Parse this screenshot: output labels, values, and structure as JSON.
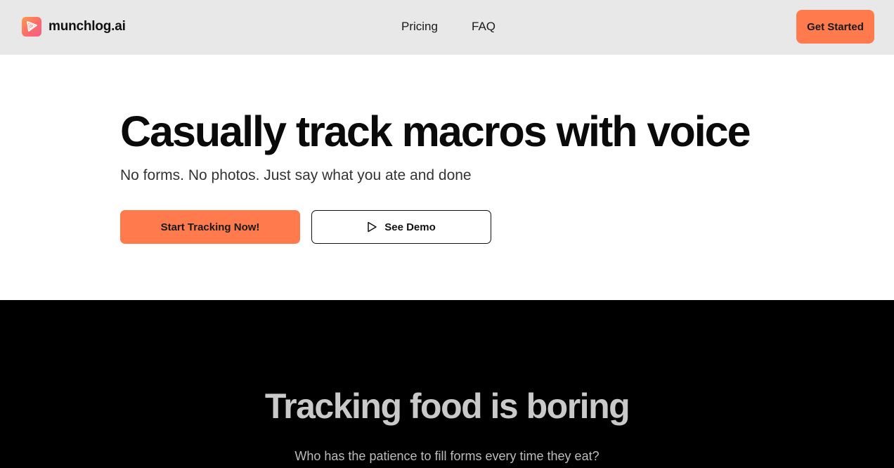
{
  "header": {
    "brand_name": "munchlog.ai",
    "logo_icon": "pizza-slice-icon",
    "nav": [
      {
        "label": "Pricing"
      },
      {
        "label": "FAQ"
      }
    ],
    "cta_label": "Get Started"
  },
  "hero": {
    "title": "Casually track macros with voice",
    "subtitle": "No forms. No photos. Just say what you ate and done",
    "primary_button": "Start Tracking Now!",
    "secondary_button": "See Demo",
    "secondary_button_icon": "play-icon"
  },
  "problem_section": {
    "title": "Tracking food is boring",
    "subtitle": "Who has the patience to fill forms every time they eat?"
  },
  "colors": {
    "accent": "#ff7a4d",
    "header_bg": "#e8e8e8",
    "dark_bg": "#000000"
  }
}
